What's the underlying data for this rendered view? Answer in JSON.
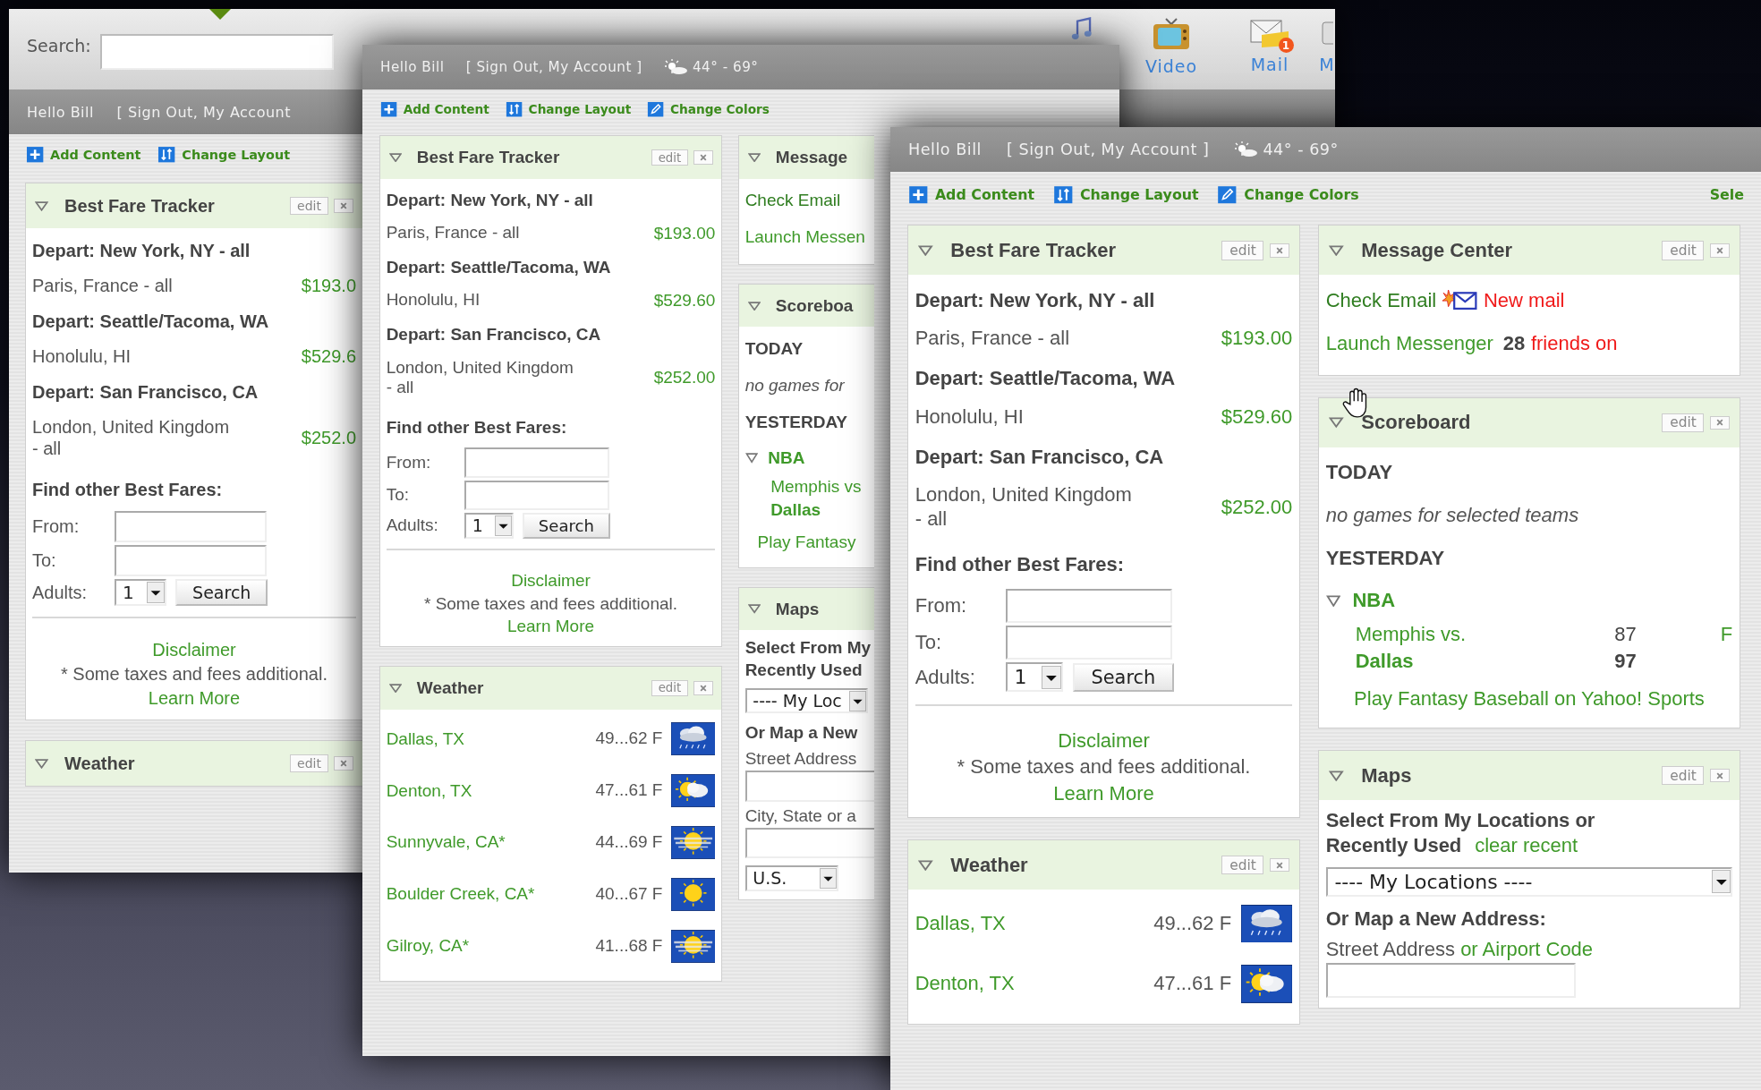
{
  "windows": [
    {
      "search": {
        "label": "Search:"
      },
      "nav": [
        {
          "kind": "music"
        },
        {
          "kind": "video",
          "label": "Video"
        },
        {
          "kind": "mail",
          "label": "Mail",
          "badge": "1"
        },
        {
          "kind": "monitor",
          "label": "M"
        }
      ],
      "greeting": "Hello Bill",
      "account": "[ Sign Out, My Account",
      "toolbar": [
        {
          "kind": "add",
          "label": "Add Content"
        },
        {
          "kind": "layout",
          "label": "Change Layout"
        }
      ],
      "columns": [
        [
          {
            "kind": "fares",
            "title": "Best Fare Tracker",
            "edit": "edit",
            "closable": true,
            "routes": [
              {
                "origin": "Depart: New York, NY - all",
                "destination": "Paris, France - all",
                "price": "$193.0"
              },
              {
                "origin": "Depart: Seattle/Tacoma, WA",
                "destination": "Honolulu, HI",
                "price": "$529.6"
              },
              {
                "origin": "Depart: San Francisco, CA",
                "destination": "London, United Kingdom - all",
                "price": "$252.0"
              }
            ],
            "search_title": "Find other Best Fares:",
            "fields": [
              {
                "label": "From:"
              },
              {
                "label": "To:"
              }
            ],
            "adults": {
              "label": "Adults:",
              "value": "1"
            },
            "button": "Search",
            "disclaimer": "Disclaimer",
            "note": "* Some taxes and fees additional.",
            "learn_more": "Learn More"
          },
          {
            "kind": "weather",
            "title": "Weather",
            "edit": "edit",
            "closable": true
          }
        ]
      ]
    },
    {
      "greeting": "Hello Bill",
      "account": "[ Sign Out, My Account ]",
      "weather": "44° - 69°",
      "toolbar": [
        {
          "kind": "add",
          "label": "Add Content"
        },
        {
          "kind": "layout",
          "label": "Change Layout"
        },
        {
          "kind": "colors",
          "label": "Change Colors"
        }
      ],
      "columns": [
        [
          {
            "kind": "fares",
            "title": "Best Fare Tracker",
            "edit": "edit",
            "closable": true,
            "routes": [
              {
                "origin": "Depart: New York, NY - all",
                "destination": "Paris, France - all",
                "price": "$193.00"
              },
              {
                "origin": "Depart: Seattle/Tacoma, WA",
                "destination": "Honolulu, HI",
                "price": "$529.60"
              },
              {
                "origin": "Depart: San Francisco, CA",
                "destination": "London, United Kingdom - all",
                "price": "$252.00"
              }
            ],
            "search_title": "Find other Best Fares:",
            "fields": [
              {
                "label": "From:"
              },
              {
                "label": "To:"
              }
            ],
            "adults": {
              "label": "Adults:",
              "value": "1"
            },
            "button": "Search",
            "disclaimer": "Disclaimer",
            "note": "* Some taxes and fees additional.",
            "learn_more": "Learn More"
          },
          {
            "kind": "weather",
            "title": "Weather",
            "edit": "edit",
            "closable": true,
            "cities": [
              {
                "city": "Dallas, TX",
                "temp": "49...62 F",
                "kind": "rain"
              },
              {
                "city": "Denton, TX",
                "temp": "47...61 F",
                "kind": "partly-cloudy"
              },
              {
                "city": "Sunnyvale, CA*",
                "temp": "44...69 F",
                "kind": "hazy"
              },
              {
                "city": "Boulder Creek, CA*",
                "temp": "40...67 F",
                "kind": "sunny"
              },
              {
                "city": "Gilroy, CA*",
                "temp": "41...68 F",
                "kind": "hazy"
              }
            ]
          }
        ],
        [
          {
            "kind": "messages",
            "title": "Message",
            "closable": false,
            "email": {
              "label": "Check Email"
            },
            "messenger": {
              "label": "Launch Messen"
            }
          },
          {
            "kind": "scoreboard",
            "title": "Scoreboa",
            "closable": false,
            "today": {
              "label": "TODAY",
              "note": "no games for"
            },
            "yesterday": "YESTERDAY",
            "leagues": [
              {
                "name": "NBA",
                "expanded": true,
                "games": [
                  {
                    "teams": [
                      {
                        "name": "Memphis vs",
                        "winner": false
                      },
                      {
                        "name": "Dallas",
                        "winner": true
                      }
                    ]
                  }
                ]
              }
            ],
            "promo": "Play Fantasy"
          },
          {
            "kind": "maps",
            "title": "Maps",
            "closable": false,
            "select_lines": [
              "Select From My",
              "Recently Used"
            ],
            "select_value": "---- My Loc",
            "new_label": "Or Map a New",
            "street_label": "Street Address",
            "city_label": "City, State or a",
            "country": "U.S."
          }
        ]
      ]
    },
    {
      "greeting": "Hello Bill",
      "account": "[ Sign Out, My Account ]",
      "weather": "44° - 69°",
      "toolbar": [
        {
          "kind": "add",
          "label": "Add Content"
        },
        {
          "kind": "layout",
          "label": "Change Layout"
        },
        {
          "kind": "colors",
          "label": "Change Colors"
        }
      ],
      "toolbar_extra": "Sele",
      "columns": [
        [
          {
            "kind": "fares",
            "title": "Best Fare Tracker",
            "edit": "edit",
            "closable": true,
            "routes": [
              {
                "origin": "Depart: New York, NY - all",
                "destination": "Paris, France - all",
                "price": "$193.00"
              },
              {
                "origin": "Depart: Seattle/Tacoma, WA",
                "destination": "Honolulu, HI",
                "price": "$529.60"
              },
              {
                "origin": "Depart: San Francisco, CA",
                "destination": "London, United Kingdom - all",
                "price": "$252.00"
              }
            ],
            "search_title": "Find other Best Fares:",
            "fields": [
              {
                "label": "From:"
              },
              {
                "label": "To:"
              }
            ],
            "adults": {
              "label": "Adults:",
              "value": "1"
            },
            "button": "Search",
            "disclaimer": "Disclaimer",
            "note": "* Some taxes and fees additional.",
            "learn_more": "Learn More"
          },
          {
            "kind": "weather",
            "title": "Weather",
            "edit": "edit",
            "closable": true,
            "cities": [
              {
                "city": "Dallas, TX",
                "temp": "49...62 F",
                "kind": "rain"
              },
              {
                "city": "Denton, TX",
                "temp": "47...61 F",
                "kind": "partly-cloudy"
              }
            ]
          }
        ],
        [
          {
            "kind": "messages",
            "title": "Message Center",
            "edit": "edit",
            "closable": true,
            "email": {
              "label": "Check Email",
              "alert": "New mail"
            },
            "messenger": {
              "label": "Launch Messenger",
              "count": "28",
              "status": "friends on"
            }
          },
          {
            "kind": "scoreboard",
            "title": "Scoreboard",
            "edit": "edit",
            "closable": true,
            "today": {
              "label": "TODAY",
              "note": "no games for selected teams"
            },
            "yesterday": "YESTERDAY",
            "leagues": [
              {
                "name": "NBA",
                "expanded": true,
                "games": [
                  {
                    "teams": [
                      {
                        "name": "Memphis vs.",
                        "score": "87",
                        "winner": false
                      },
                      {
                        "name": "Dallas",
                        "score": "97",
                        "winner": true
                      }
                    ],
                    "status": "F"
                  }
                ]
              }
            ],
            "promo": "Play Fantasy Baseball on Yahoo! Sports"
          },
          {
            "kind": "maps",
            "title": "Maps",
            "edit": "edit",
            "closable": true,
            "select_lines": [
              "Select From My Locations or",
              "Recently Used"
            ],
            "clear_link": "clear recent",
            "select_value": "---- My Locations ----",
            "new_label": "Or Map a New Address:",
            "street_label": "Street Address",
            "street_link": "or Airport Code"
          }
        ]
      ]
    }
  ]
}
